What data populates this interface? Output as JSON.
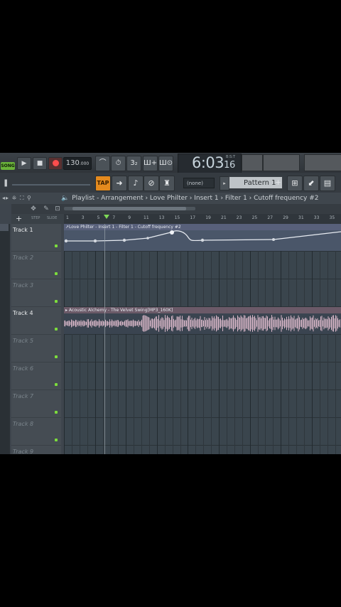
{
  "transport": {
    "mode_label": "SONG",
    "play_glyph": "▶",
    "stop_glyph": "■",
    "tempo": "130",
    "tempo_decimal": ".000",
    "time_main": "6:03",
    "time_small": "16",
    "time_unit_label": "B:S:T",
    "tool_buttons": [
      "⌒",
      "⏱",
      "3₂",
      "Ш+",
      "Ш⊙"
    ]
  },
  "toolbar2": {
    "pattern_none": "(none)",
    "pattern_label": "Pattern 1",
    "pattern_plus": "+",
    "tool_buttons": [
      "TAP",
      "➜",
      "♪",
      "⊘",
      "♜"
    ],
    "right_icons": [
      "⊞",
      "⬋",
      "▤",
      "⇆"
    ]
  },
  "titlebar": {
    "nav_arrows": "◂▸ ⁜ ⛶ ⚲",
    "breadcrumb": "Playlist - Arrangement › Love Philter › Insert 1 › Filter 1 › Cutoff frequency #2"
  },
  "header": {
    "plus": "+",
    "step_label": "STEP",
    "slide_label": "SLIDE"
  },
  "ruler": [
    "1",
    "3",
    "5",
    "7",
    "9",
    "11",
    "13",
    "15",
    "17",
    "19",
    "21",
    "23",
    "25",
    "27",
    "29",
    "31",
    "33",
    "35"
  ],
  "tracks": [
    {
      "name": "Track 1",
      "active": true
    },
    {
      "name": "Track 2",
      "active": false
    },
    {
      "name": "Track 3",
      "active": false
    },
    {
      "name": "Track 4",
      "active": true
    },
    {
      "name": "Track 5",
      "active": false
    },
    {
      "name": "Track 6",
      "active": false
    },
    {
      "name": "Track 7",
      "active": false
    },
    {
      "name": "Track 8",
      "active": false
    },
    {
      "name": "Track 9",
      "active": false
    }
  ],
  "clips": {
    "automation_title": "↗Love Philter - Insert 1 - Filter 1 - Cutoff frequency #2",
    "audio_title": "▸ Acoustic Alchemy - The Velvet Swing[MP3_160K]"
  },
  "colors": {
    "accent_orange": "#e48a1e",
    "led_green": "#7cdd3c",
    "song_badge": "#6ab23a",
    "record_red": "#ff4d4d"
  }
}
